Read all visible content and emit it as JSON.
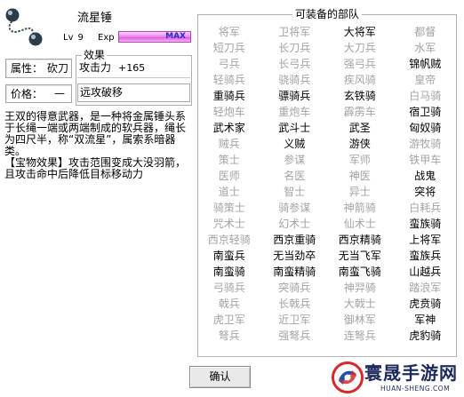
{
  "item": {
    "icon": "meteor-hammer-icon",
    "name": "流星锤",
    "level_label": "Lv",
    "level": "9",
    "exp_label": "Exp",
    "exp_value": "MAX",
    "exp_fraction": 1.0,
    "attribute_label": "属性：",
    "attribute_value": "砍刀",
    "price_label": "价格：",
    "price_value": "—"
  },
  "effects": {
    "legend": "效果",
    "stat_name": "攻击力",
    "stat_value": "+165",
    "special": "远攻破移"
  },
  "description": {
    "lines": [
      "王双的得意武器，是一种将金属锤头系",
      "于长绳一端或两端制成的软兵器，绳长",
      "为四尺半，称“双流星”，属索系暗器",
      "类。",
      "【宝物效果】攻击范围变成大没羽箭，",
      "且攻击命中后降低目标移动力"
    ]
  },
  "units": {
    "title": "可装备的部队",
    "rows": [
      [
        {
          "name": "将军",
          "enabled": false
        },
        {
          "name": "卫将军",
          "enabled": false
        },
        {
          "name": "大将军",
          "enabled": true
        },
        {
          "name": "都督",
          "enabled": false
        }
      ],
      [
        {
          "name": "短刀兵",
          "enabled": false
        },
        {
          "name": "长刀兵",
          "enabled": false
        },
        {
          "name": "大刀兵",
          "enabled": false
        },
        {
          "name": "水军",
          "enabled": false
        }
      ],
      [
        {
          "name": "弓兵",
          "enabled": false
        },
        {
          "name": "长弓兵",
          "enabled": false
        },
        {
          "name": "强弓兵",
          "enabled": false
        },
        {
          "name": "锦帆贼",
          "enabled": true
        }
      ],
      [
        {
          "name": "轻骑兵",
          "enabled": false
        },
        {
          "name": "骁骑兵",
          "enabled": false
        },
        {
          "name": "疾风骑",
          "enabled": false
        },
        {
          "name": "皇帝",
          "enabled": false
        }
      ],
      [
        {
          "name": "重骑兵",
          "enabled": true
        },
        {
          "name": "骠骑兵",
          "enabled": true
        },
        {
          "name": "玄铁骑",
          "enabled": true
        },
        {
          "name": "白马骑",
          "enabled": false
        }
      ],
      [
        {
          "name": "轻炮车",
          "enabled": false
        },
        {
          "name": "重炮车",
          "enabled": false
        },
        {
          "name": "霹雳车",
          "enabled": false
        },
        {
          "name": "宿卫骑",
          "enabled": true
        }
      ],
      [
        {
          "name": "武术家",
          "enabled": true
        },
        {
          "name": "武斗士",
          "enabled": true
        },
        {
          "name": "武圣",
          "enabled": true
        },
        {
          "name": "匈奴骑",
          "enabled": true
        }
      ],
      [
        {
          "name": "贼兵",
          "enabled": false
        },
        {
          "name": "义贼",
          "enabled": true
        },
        {
          "name": "游侠",
          "enabled": true
        },
        {
          "name": "游牧骑",
          "enabled": false
        }
      ],
      [
        {
          "name": "策士",
          "enabled": false
        },
        {
          "name": "参谋",
          "enabled": false
        },
        {
          "name": "军师",
          "enabled": false
        },
        {
          "name": "铁甲车",
          "enabled": false
        }
      ],
      [
        {
          "name": "医师",
          "enabled": false
        },
        {
          "name": "名医",
          "enabled": false
        },
        {
          "name": "神医",
          "enabled": false
        },
        {
          "name": "战鬼",
          "enabled": true
        }
      ],
      [
        {
          "name": "道士",
          "enabled": false
        },
        {
          "name": "智士",
          "enabled": false
        },
        {
          "name": "异士",
          "enabled": false
        },
        {
          "name": "突将",
          "enabled": true
        }
      ],
      [
        {
          "name": "骑策士",
          "enabled": false
        },
        {
          "name": "骑参谋",
          "enabled": false
        },
        {
          "name": "神箭骑",
          "enabled": false
        },
        {
          "name": "白耗兵",
          "enabled": false
        }
      ],
      [
        {
          "name": "咒术士",
          "enabled": false
        },
        {
          "name": "幻术士",
          "enabled": false
        },
        {
          "name": "仙术士",
          "enabled": false
        },
        {
          "name": "蛮族骑",
          "enabled": true
        }
      ],
      [
        {
          "name": "西京轻骑",
          "enabled": false
        },
        {
          "name": "西京重骑",
          "enabled": true
        },
        {
          "name": "西京精骑",
          "enabled": true
        },
        {
          "name": "上将军",
          "enabled": true
        }
      ],
      [
        {
          "name": "南蛮兵",
          "enabled": true
        },
        {
          "name": "无当劲卒",
          "enabled": true
        },
        {
          "name": "无当飞军",
          "enabled": true
        },
        {
          "name": "蛮族兵",
          "enabled": true
        }
      ],
      [
        {
          "name": "南蛮骑",
          "enabled": true
        },
        {
          "name": "南蛮精骑",
          "enabled": true
        },
        {
          "name": "南蛮飞骑",
          "enabled": true
        },
        {
          "name": "山越兵",
          "enabled": true
        }
      ],
      [
        {
          "name": "弓骑兵",
          "enabled": false
        },
        {
          "name": "突骑兵",
          "enabled": false
        },
        {
          "name": "神羿骑",
          "enabled": false
        },
        {
          "name": "踏浪军",
          "enabled": false
        }
      ],
      [
        {
          "name": "戟兵",
          "enabled": false
        },
        {
          "name": "长戟兵",
          "enabled": false
        },
        {
          "name": "大戟士",
          "enabled": false
        },
        {
          "name": "虎贲骑",
          "enabled": true
        }
      ],
      [
        {
          "name": "虎卫军",
          "enabled": false
        },
        {
          "name": "近卫军",
          "enabled": false
        },
        {
          "name": "御林军",
          "enabled": false
        },
        {
          "name": "军神",
          "enabled": true
        }
      ],
      [
        {
          "name": "弩兵",
          "enabled": false
        },
        {
          "name": "强弩兵",
          "enabled": false
        },
        {
          "name": "连弩兵",
          "enabled": false
        },
        {
          "name": "虎豹骑",
          "enabled": true
        }
      ]
    ]
  },
  "buttons": {
    "confirm": "确认"
  },
  "watermark": {
    "logo_icon": "logo-icon",
    "name": "寰晟手游网",
    "site": "HUAN-SHENG.COM"
  },
  "colors": {
    "enabled_text": "#000000",
    "disabled_text": "#a3a3a3",
    "exp_bar": "#e060e0",
    "max_text": "#2c2cc8",
    "watermark_text": "#1e2a5a",
    "watermark_red": "#d42a2a"
  }
}
